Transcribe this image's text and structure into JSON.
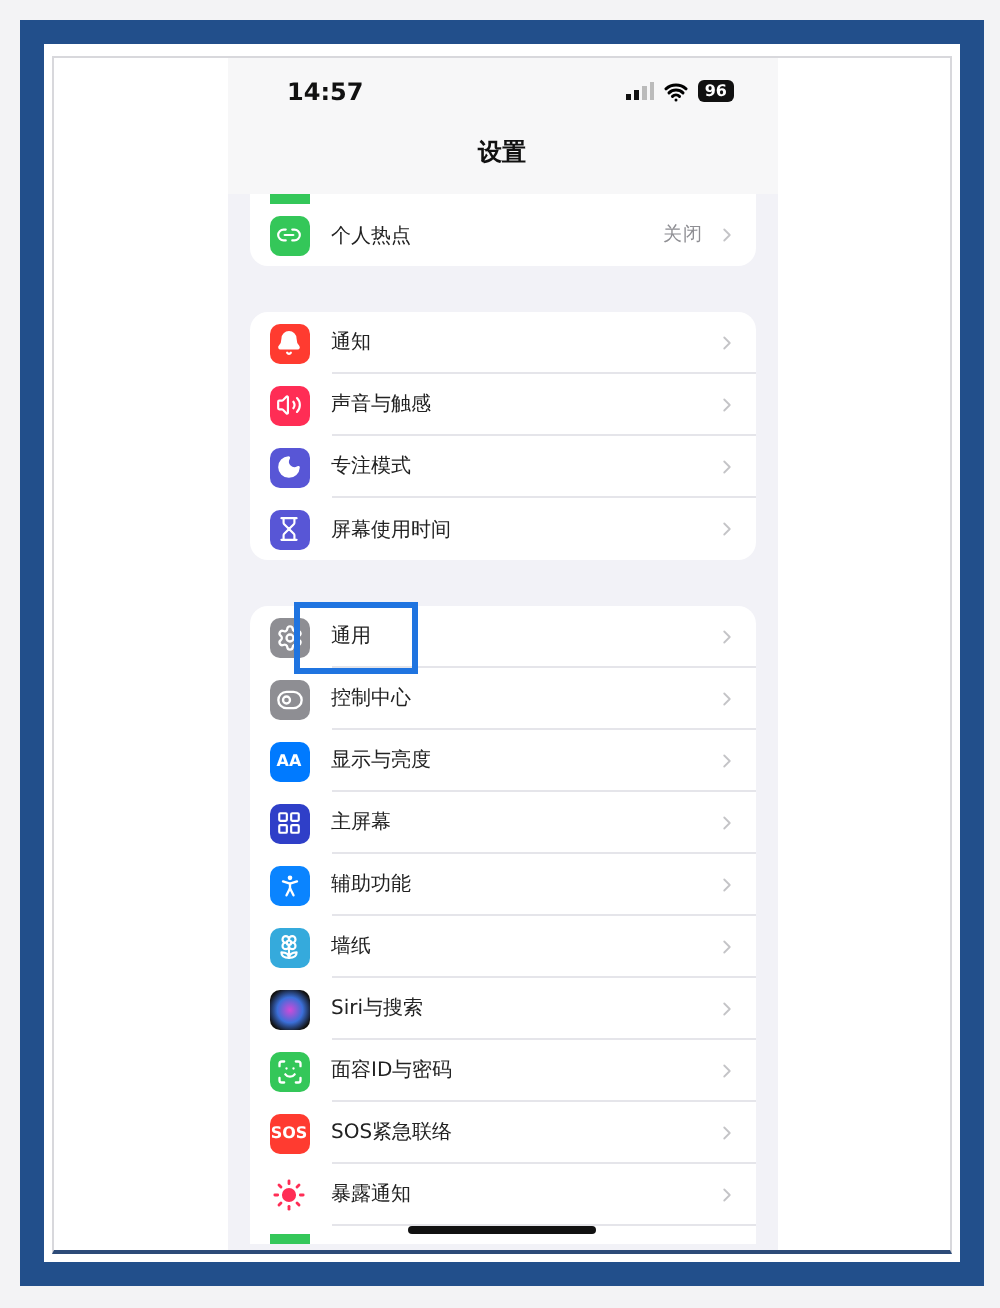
{
  "status_bar": {
    "time": "14:57",
    "battery": "96"
  },
  "title": "设置",
  "groups": [
    {
      "items": [
        {
          "kind": "cut"
        },
        {
          "kind": "hotspot",
          "label": "个人热点",
          "value": "关闭",
          "highlighted": false
        }
      ]
    },
    {
      "items": [
        {
          "kind": "notifications",
          "label": "通知",
          "highlighted": false
        },
        {
          "kind": "sound",
          "label": "声音与触感",
          "highlighted": false
        },
        {
          "kind": "focus",
          "label": "专注模式",
          "highlighted": false
        },
        {
          "kind": "screentime",
          "label": "屏幕使用时间",
          "highlighted": false
        }
      ]
    },
    {
      "items": [
        {
          "kind": "general",
          "label": "通用",
          "highlighted": true
        },
        {
          "kind": "control",
          "label": "控制中心",
          "highlighted": false
        },
        {
          "kind": "display",
          "icon_text": "AA",
          "label": "显示与亮度",
          "highlighted": false
        },
        {
          "kind": "home",
          "label": "主屏幕",
          "highlighted": false
        },
        {
          "kind": "accessibility",
          "label": "辅助功能",
          "highlighted": false
        },
        {
          "kind": "wallpaper",
          "label": "墙纸",
          "highlighted": false
        },
        {
          "kind": "siri",
          "label": "Siri与搜索",
          "highlighted": false
        },
        {
          "kind": "faceid",
          "label": "面容ID与密码",
          "highlighted": false
        },
        {
          "kind": "sos",
          "icon_text": "SOS",
          "label": "SOS紧急联络",
          "highlighted": false
        },
        {
          "kind": "exposure",
          "label": "暴露通知",
          "highlighted": false
        },
        {
          "kind": "cut"
        }
      ]
    }
  ]
}
